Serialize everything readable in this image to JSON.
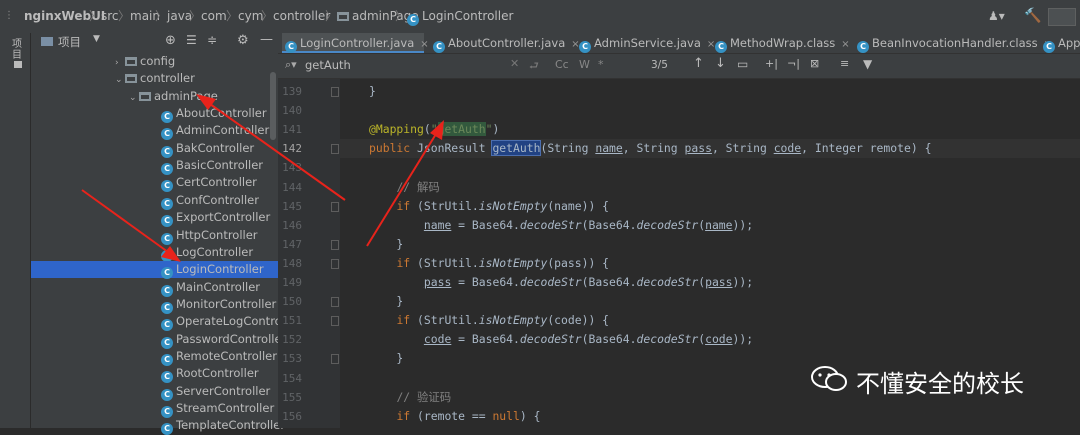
{
  "breadcrumb": [
    "nginxWebUI",
    "src",
    "main",
    "java",
    "com",
    "cym",
    "controller",
    "adminPage",
    "LoginController"
  ],
  "stripe_label": "项目",
  "project": {
    "title": "项目",
    "tree": [
      {
        "label": "config",
        "type": "folder",
        "depth": 1,
        "expanded": false
      },
      {
        "label": "controller",
        "type": "folder",
        "depth": 1,
        "expanded": true
      },
      {
        "label": "adminPage",
        "type": "folder",
        "depth": 2,
        "expanded": true
      },
      {
        "label": "AboutController",
        "type": "class",
        "depth": 3
      },
      {
        "label": "AdminController",
        "type": "class",
        "depth": 3
      },
      {
        "label": "BakController",
        "type": "class",
        "depth": 3
      },
      {
        "label": "BasicController",
        "type": "class",
        "depth": 3
      },
      {
        "label": "CertController",
        "type": "class",
        "depth": 3
      },
      {
        "label": "ConfController",
        "type": "class",
        "depth": 3
      },
      {
        "label": "ExportController",
        "type": "class",
        "depth": 3
      },
      {
        "label": "HttpController",
        "type": "class",
        "depth": 3
      },
      {
        "label": "LogController",
        "type": "class",
        "depth": 3
      },
      {
        "label": "LoginController",
        "type": "class",
        "depth": 3,
        "selected": true
      },
      {
        "label": "MainController",
        "type": "class",
        "depth": 3
      },
      {
        "label": "MonitorController",
        "type": "class",
        "depth": 3
      },
      {
        "label": "OperateLogControll",
        "type": "class",
        "depth": 3
      },
      {
        "label": "PasswordController",
        "type": "class",
        "depth": 3
      },
      {
        "label": "RemoteController",
        "type": "class",
        "depth": 3
      },
      {
        "label": "RootController",
        "type": "class",
        "depth": 3
      },
      {
        "label": "ServerController",
        "type": "class",
        "depth": 3
      },
      {
        "label": "StreamController",
        "type": "class",
        "depth": 3
      },
      {
        "label": "TemplateController",
        "type": "class",
        "depth": 3
      }
    ]
  },
  "tabs": [
    {
      "label": "LoginController.java",
      "active": true
    },
    {
      "label": "AboutController.java",
      "active": false
    },
    {
      "label": "AdminService.java",
      "active": false
    },
    {
      "label": "MethodWrap.class",
      "active": false
    },
    {
      "label": "BeanInvocationHandler.class",
      "active": false
    },
    {
      "label": "App",
      "active": false
    }
  ],
  "search": {
    "query": "getAuth",
    "match_case": "Cc",
    "words": "W",
    "regex": "*",
    "count": "3/5"
  },
  "code": {
    "current_line": 142,
    "lines": [
      {
        "n": 139,
        "html": "}"
      },
      {
        "n": 140,
        "html": ""
      },
      {
        "n": 141,
        "html": "<span class='ann'>@Mapping</span>(<span class='str'>\"<span class='hl'>getAuth</span>\"</span>)"
      },
      {
        "n": 142,
        "html": "<span class='kw'>public</span> JsonResult <span class='hlsel'>getAuth</span>(String <span class='ul'>name</span>, String <span class='ul'>pass</span>, String <span class='ul'>code</span>, Integer remote) {"
      },
      {
        "n": 143,
        "html": ""
      },
      {
        "n": 144,
        "html": "    <span class='cm'>// 解码</span>"
      },
      {
        "n": 145,
        "html": "    <span class='kw'>if</span> (StrUtil.<span class='it'>isNotEmpty</span>(name)) {"
      },
      {
        "n": 146,
        "html": "        <span class='ul'>name</span> = Base64.<span class='it'>decodeStr</span>(Base64.<span class='it'>decodeStr</span>(<span class='ul'>name</span>));"
      },
      {
        "n": 147,
        "html": "    }"
      },
      {
        "n": 148,
        "html": "    <span class='kw'>if</span> (StrUtil.<span class='it'>isNotEmpty</span>(pass)) {"
      },
      {
        "n": 149,
        "html": "        <span class='ul'>pass</span> = Base64.<span class='it'>decodeStr</span>(Base64.<span class='it'>decodeStr</span>(<span class='ul'>pass</span>));"
      },
      {
        "n": 150,
        "html": "    }"
      },
      {
        "n": 151,
        "html": "    <span class='kw'>if</span> (StrUtil.<span class='it'>isNotEmpty</span>(code)) {"
      },
      {
        "n": 152,
        "html": "        <span class='ul'>code</span> = Base64.<span class='it'>decodeStr</span>(Base64.<span class='it'>decodeStr</span>(<span class='ul'>code</span>));"
      },
      {
        "n": 153,
        "html": "    }"
      },
      {
        "n": 154,
        "html": ""
      },
      {
        "n": 155,
        "html": "    <span class='cm'>// 验证码</span>"
      },
      {
        "n": 156,
        "html": "    <span class='kw'>if</span> (remote == <span class='kw'>null</span>) {"
      }
    ]
  },
  "watermark": "不懂安全的校长",
  "colors": {
    "annotation_arrows": "#e8231b",
    "selection": "#2f65ca",
    "class_icon": "#3592c4"
  }
}
